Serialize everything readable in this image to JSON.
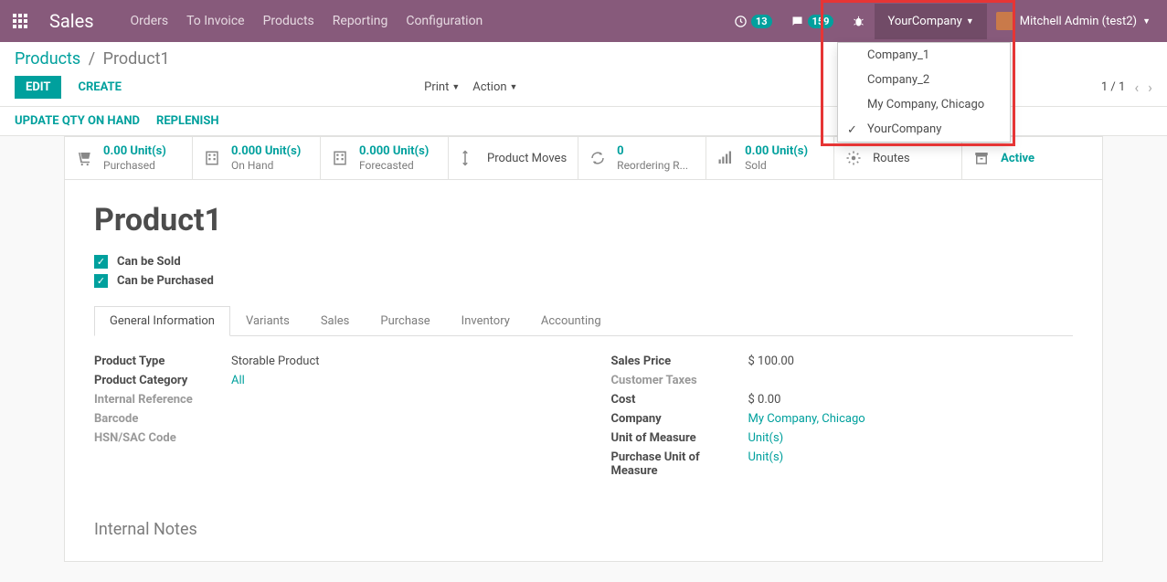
{
  "topbar": {
    "app_title": "Sales",
    "menus": [
      "Orders",
      "To Invoice",
      "Products",
      "Reporting",
      "Configuration"
    ],
    "activity_count": "13",
    "message_count": "159",
    "company_label": "YourCompany",
    "user_name": "Mitchell Admin (test2)"
  },
  "company_dropdown": {
    "items": [
      "Company_1",
      "Company_2",
      "My Company, Chicago",
      "YourCompany"
    ],
    "selected_index": 3
  },
  "breadcrumb": {
    "parent": "Products",
    "current": "Product1"
  },
  "controls": {
    "edit": "EDIT",
    "create": "CREATE",
    "print": "Print",
    "action": "Action",
    "pager": "1 / 1",
    "update_qty": "UPDATE QTY ON HAND",
    "replenish": "REPLENISH"
  },
  "stats": {
    "purchased": {
      "value": "0.00 Unit(s)",
      "label": "Purchased"
    },
    "onhand": {
      "value": "0.000 Unit(s)",
      "label": "On Hand"
    },
    "forecasted": {
      "value": "0.000 Unit(s)",
      "label": "Forecasted"
    },
    "moves": "Product Moves",
    "reorder": {
      "value": "0",
      "label": "Reordering R..."
    },
    "sold": {
      "value": "0.00 Unit(s)",
      "label": "Sold"
    },
    "routes": "Routes",
    "active": "Active"
  },
  "product": {
    "name": "Product1",
    "can_be_sold": "Can be Sold",
    "can_be_purchased": "Can be Purchased"
  },
  "tabs": [
    "General Information",
    "Variants",
    "Sales",
    "Purchase",
    "Inventory",
    "Accounting"
  ],
  "fields_left": {
    "product_type": {
      "label": "Product Type",
      "value": "Storable Product"
    },
    "category": {
      "label": "Product Category",
      "value": "All"
    },
    "internal_ref": {
      "label": "Internal Reference",
      "value": ""
    },
    "barcode": {
      "label": "Barcode",
      "value": ""
    },
    "hsn": {
      "label": "HSN/SAC Code",
      "value": ""
    }
  },
  "fields_right": {
    "sales_price": {
      "label": "Sales Price",
      "value": "$ 100.00"
    },
    "customer_taxes": {
      "label": "Customer Taxes",
      "value": ""
    },
    "cost": {
      "label": "Cost",
      "value": "$ 0.00"
    },
    "company": {
      "label": "Company",
      "value": "My Company, Chicago"
    },
    "uom": {
      "label": "Unit of Measure",
      "value": "Unit(s)"
    },
    "purchase_uom": {
      "label": "Purchase Unit of Measure",
      "value": "Unit(s)"
    }
  },
  "section": {
    "internal_notes": "Internal Notes"
  }
}
